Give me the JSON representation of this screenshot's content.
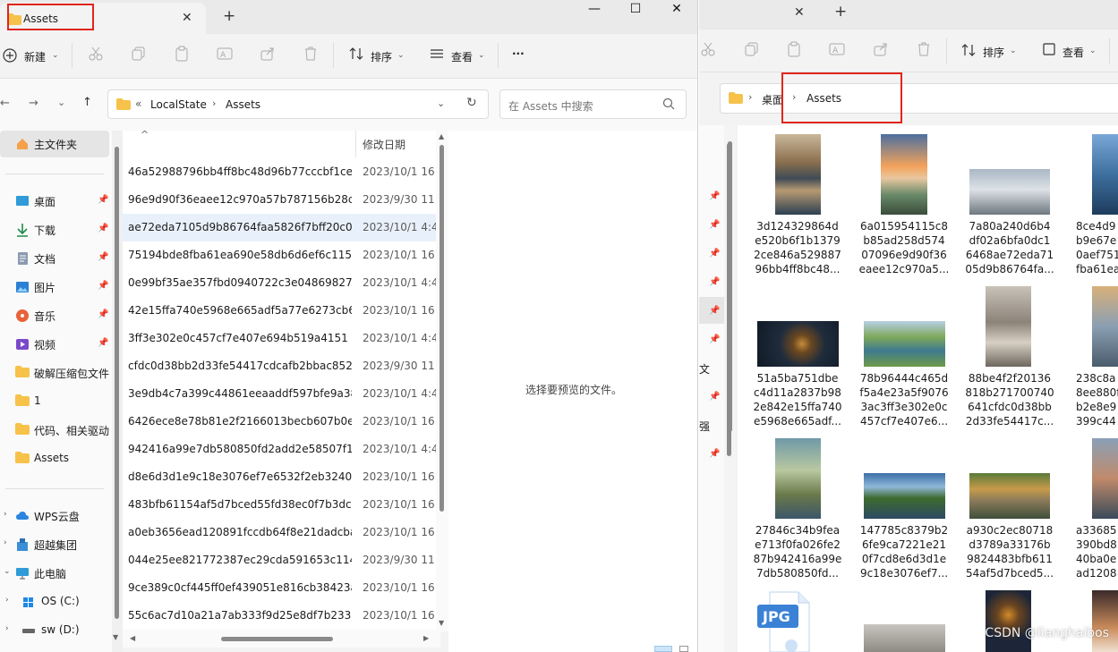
{
  "left_window": {
    "tab_title": "Assets",
    "tab_close": "✕",
    "new_tab": "+",
    "window_controls": {
      "minimize": "—",
      "maximize": "☐",
      "close": "✕"
    },
    "toolbar": {
      "new_label": "新建",
      "sort_label": "排序",
      "view_label": "查看",
      "more_label": "···"
    },
    "address": {
      "prefix": "«",
      "crumbs": [
        "LocalState",
        "Assets"
      ]
    },
    "search": {
      "placeholder": "在 Assets 中搜索"
    },
    "sidebar": {
      "home": "主文件夹",
      "quick": [
        "桌面",
        "下载",
        "文档",
        "图片",
        "音乐",
        "视频",
        "破解压缩包文件",
        "1",
        "代码、相关驱动",
        "Assets"
      ],
      "cloud": [
        "WPS云盘",
        "超越集团"
      ],
      "this_pc": "此电脑",
      "drives": [
        "OS (C:)",
        "sw (D:)"
      ]
    },
    "list": {
      "col_date": "修改日期",
      "rows": [
        {
          "name": "46a52988796bb4ff8bc48d96b77cccbf1ce",
          "date": "2023/10/1 16:"
        },
        {
          "name": "96e9d90f36eaee12c970a57b787156b28ca6",
          "date": "2023/9/30 11:"
        },
        {
          "name": "ae72eda7105d9b86764faa5826f7bff20c0",
          "date": "2023/10/1 4:4"
        },
        {
          "name": "75194bde8fba61ea690e58db6d6ef6c1157",
          "date": "2023/10/1 16:"
        },
        {
          "name": "0e99bf35ae357fbd0940722c3e048698270",
          "date": "2023/10/1 4:4"
        },
        {
          "name": "42e15ffa740e5968e665adf5a77e6273cb6d",
          "date": "2023/10/1 16:"
        },
        {
          "name": "3ff3e302e0c457cf7e407e694b519a4151",
          "date": "2023/10/1 4:4"
        },
        {
          "name": "cfdc0d38bb2d33fe54417cdcafb2bbac852",
          "date": "2023/9/30 11:"
        },
        {
          "name": "3e9db4c7a399c44861eeaaddf597bfe9a38",
          "date": "2023/10/1 4:4"
        },
        {
          "name": "6426ece8e78b81e2f2166013becb607b0ef",
          "date": "2023/10/1 16:"
        },
        {
          "name": "942416a99e7db580850fd2add2e58507f1",
          "date": "2023/10/1 4:4"
        },
        {
          "name": "d8e6d3d1e9c18e3076ef7e6532f2eb3240",
          "date": "2023/10/1 16:"
        },
        {
          "name": "483bfb61154af5d7bced55fd38ec0f7b3dc",
          "date": "2023/10/1 16:"
        },
        {
          "name": "a0eb3656ead120891fccdb64f8e21dadcba0",
          "date": "2023/10/1 16:"
        },
        {
          "name": "044e25ee821772387ec29cda591653c1147",
          "date": "2023/9/30 11:"
        },
        {
          "name": "9ce389c0cf445ff0ef439051e816cb38423a",
          "date": "2023/10/1 16:"
        },
        {
          "name": "55c6ac7d10a21a7ab333f9d25e8df7b2332",
          "date": "2023/10/1 16:"
        }
      ]
    },
    "preview_message": "选择要预览的文件。"
  },
  "right_window": {
    "tab_close": "✕",
    "new_tab": "+",
    "toolbar": {
      "sort_label": "排序",
      "view_label": "查看"
    },
    "address": {
      "crumbs": [
        "桌面",
        "Assets"
      ]
    },
    "sidebar_fragments": [
      "文",
      "强"
    ],
    "thumbnails": [
      {
        "caption": "3d124329864d\ne520b6f1b1379\n2ce846a529887\n96bb4ff8bc48..."
      },
      {
        "caption": "6a015954115c8\nb85ad258d574\n07096e9d90f36\neaee12c970a5..."
      },
      {
        "caption": "7a80a240d6b4\ndf02a6bfa0dc1\n6468ae72eda71\n05d9b86764fa..."
      },
      {
        "caption": "8ce4d9\nb9e67e\n0aef751\nfba61ea"
      },
      {
        "caption": "51a5ba751dbe\nc4d11a2837b98\n2e842e15ffa740\ne5968e665adf..."
      },
      {
        "caption": "78b96444c465d\nf5a4e23a5f9076\n3ac3ff3e302e0c\n457cf7e407e6..."
      },
      {
        "caption": "88be4f2f20136\n818b271700740\n641cfdc0d38bb\n2d33fe54417c..."
      },
      {
        "caption": "238c8a\n8ee880f\nb2e8e9\n399c44"
      },
      {
        "caption": "27846c34b9fea\ne713f0fa026fe2\n87b942416a99e\n7db580850fd..."
      },
      {
        "caption": "147785c8379b2\n6fe9ca7221e21\n0f7cd8e6d3d1e\n9c18e3076ef7..."
      },
      {
        "caption": "a930c2ec80718\nd3789a33176b\n9824483bfb611\n54af5d7bced5..."
      },
      {
        "caption": "a33685\n390bd8\n40ba0e\nad1208"
      }
    ],
    "jpg_label": "JPG"
  },
  "watermark": "CSDN @lianghaibos"
}
